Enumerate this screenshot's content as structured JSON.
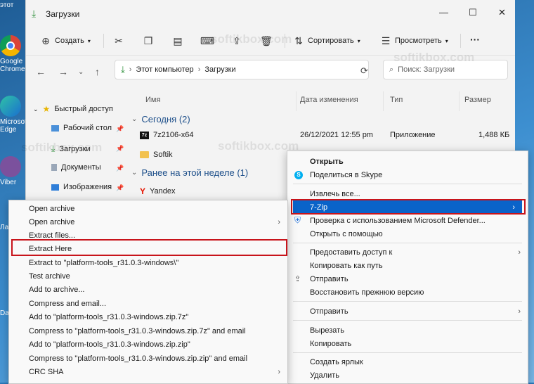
{
  "desktop": {
    "icons": [
      {
        "label": "этот",
        "icon": "pc-icon"
      },
      {
        "label": "Google Chrome",
        "icon": "chrome-icon"
      },
      {
        "label": "Microsoft Edge",
        "icon": "edge-icon"
      },
      {
        "label": "Viber",
        "icon": "viber-icon"
      }
    ],
    "left_strip": [
      "Ла",
      "Da"
    ]
  },
  "window": {
    "title": "Загрузки",
    "controls": {
      "minimize": "—",
      "maximize": "☐",
      "close": "✕"
    }
  },
  "toolbar": {
    "create": "Создать",
    "sort": "Сортировать",
    "view": "Просмотреть",
    "more": "···"
  },
  "address": {
    "path": [
      "Этот компьютер",
      "Загрузки"
    ],
    "search_placeholder": "Поиск: Загрузки"
  },
  "sidebar": {
    "items": [
      {
        "label": "Быстрый доступ",
        "icon": "star-icon"
      },
      {
        "label": "Рабочий стол",
        "icon": "desktop-icon"
      },
      {
        "label": "Загрузки",
        "icon": "download-icon"
      },
      {
        "label": "Документы",
        "icon": "document-icon"
      },
      {
        "label": "Изображения",
        "icon": "image-icon"
      }
    ]
  },
  "columns": [
    "Имя",
    "Дата изменения",
    "Тип",
    "Размер"
  ],
  "groups": [
    {
      "label": "Сегодня (2)"
    },
    {
      "label": "Ранее на этой неделе (1)"
    }
  ],
  "files": [
    {
      "name": "7z2106-x64",
      "date": "26/12/2021 12:55 pm",
      "type": "Приложение",
      "size": "1,488 КБ"
    },
    {
      "name": "Softik",
      "date": "",
      "type": "",
      "size": ""
    },
    {
      "name": "Yandex",
      "date": "",
      "type": "",
      "size": ""
    }
  ],
  "context_menu": {
    "items": [
      {
        "label": "Открыть",
        "bold": true
      },
      {
        "label": "Поделиться в Skype"
      },
      {
        "label": "Извлечь все..."
      },
      {
        "label": "7-Zip",
        "submenu": true,
        "highlighted": true
      },
      {
        "label": "Проверка с использованием Microsoft Defender..."
      },
      {
        "label": "Открыть с помощью",
        "submenu": true
      },
      {
        "label": "Предоставить доступ к",
        "submenu": true
      },
      {
        "label": "Копировать как путь"
      },
      {
        "label": "Отправить"
      },
      {
        "label": "Восстановить прежнюю версию"
      },
      {
        "label": "Отправить",
        "submenu": true
      },
      {
        "label": "Вырезать"
      },
      {
        "label": "Копировать"
      },
      {
        "label": "Создать ярлык"
      },
      {
        "label": "Удалить"
      }
    ]
  },
  "sevenzip_menu": {
    "items": [
      {
        "label": "Open archive"
      },
      {
        "label": "Open archive",
        "submenu": true
      },
      {
        "label": "Extract files..."
      },
      {
        "label": "Extract Here",
        "boxed": true
      },
      {
        "label": "Extract to \"platform-tools_r31.0.3-windows\\\""
      },
      {
        "label": "Test archive"
      },
      {
        "label": "Add to archive..."
      },
      {
        "label": "Compress and email..."
      },
      {
        "label": "Add to \"platform-tools_r31.0.3-windows.zip.7z\""
      },
      {
        "label": "Compress to \"platform-tools_r31.0.3-windows.zip.7z\" and email"
      },
      {
        "label": "Add to \"platform-tools_r31.0.3-windows.zip.zip\""
      },
      {
        "label": "Compress to \"platform-tools_r31.0.3-windows.zip.zip\" and email"
      },
      {
        "label": "CRC SHA",
        "submenu": true
      }
    ]
  },
  "watermark": "softikbox.com",
  "colors": {
    "highlight": "#0a63c9",
    "red_box": "#c8141b",
    "accent_green": "#2d8f3a"
  }
}
